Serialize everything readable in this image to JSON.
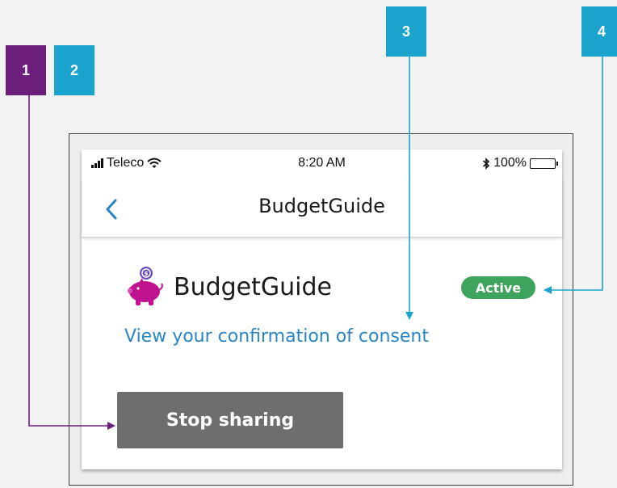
{
  "callouts": [
    "1",
    "2",
    "3",
    "4"
  ],
  "status_bar": {
    "carrier": "Teleco",
    "time": "8:20 AM",
    "battery": "100%"
  },
  "nav": {
    "title": "BudgetGuide",
    "back_icon": "chevron-left-icon"
  },
  "app": {
    "name": "BudgetGuide",
    "icon": "piggy-bank-icon",
    "status": "Active",
    "consent_link": "View your confirmation of consent",
    "stop_button": "Stop sharing"
  },
  "colors": {
    "callout_purple": "#6d1f7c",
    "callout_cyan": "#1aa3cc",
    "active_green": "#3da35d",
    "link_blue": "#2a86c2",
    "button_gray": "#6e6e6e",
    "piggy_magenta": "#c0138f"
  }
}
